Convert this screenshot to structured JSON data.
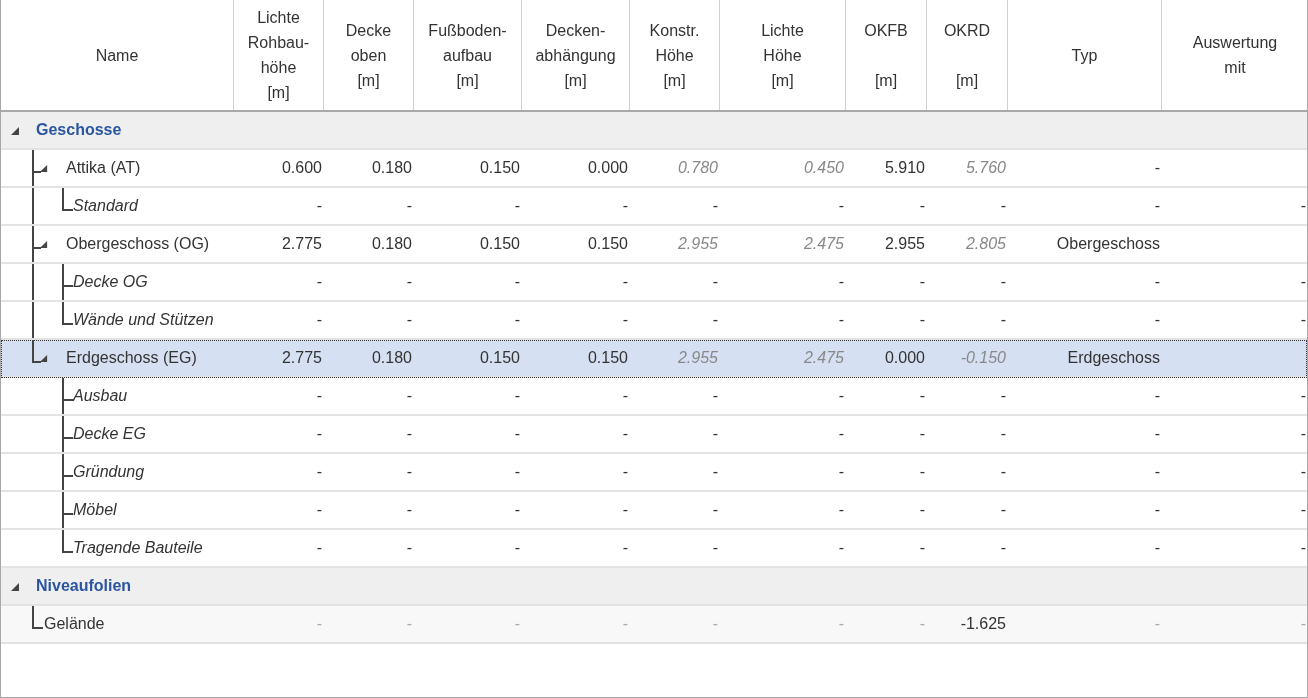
{
  "table": {
    "columns": [
      "Name",
      "Lichte\nRohbau-\nhöhe\n[m]",
      "Decke\noben\n[m]",
      "Fußboden-\naufbau\n[m]",
      "Decken-\nabhängung\n[m]",
      "Konstr.\nHöhe\n[m]",
      "Lichte\nHöhe\n[m]",
      "OKFB\n\n[m]",
      "OKRD\n\n[m]",
      "Typ",
      "Auswertung\nmit"
    ],
    "groups": [
      {
        "label": "Geschosse",
        "expanded": true,
        "children": [
          {
            "kind": "story",
            "name": "Attika (AT)",
            "expanded": true,
            "selected": false,
            "cells": [
              {
                "text": "0.600",
                "italic": false
              },
              {
                "text": "0.180",
                "italic": false
              },
              {
                "text": "0.150",
                "italic": false
              },
              {
                "text": "0.000",
                "italic": false
              },
              {
                "text": "0.780",
                "italic": true
              },
              {
                "text": "0.450",
                "italic": true
              },
              {
                "text": "5.910",
                "italic": false
              },
              {
                "text": "5.760",
                "italic": true
              },
              {
                "text": "-",
                "italic": false
              }
            ],
            "children": [
              {
                "kind": "part",
                "name": "Standard",
                "selected": false,
                "cells": [
                  "-",
                  "-",
                  "-",
                  "-",
                  "-",
                  "-",
                  "-",
                  "-",
                  "-",
                  "-"
                ]
              }
            ]
          },
          {
            "kind": "story",
            "name": "Obergeschoss (OG)",
            "expanded": true,
            "selected": false,
            "cells": [
              {
                "text": "2.775",
                "italic": false
              },
              {
                "text": "0.180",
                "italic": false
              },
              {
                "text": "0.150",
                "italic": false
              },
              {
                "text": "0.150",
                "italic": false
              },
              {
                "text": "2.955",
                "italic": true
              },
              {
                "text": "2.475",
                "italic": true
              },
              {
                "text": "2.955",
                "italic": false
              },
              {
                "text": "2.805",
                "italic": true
              },
              {
                "text": "Obergeschoss",
                "italic": false
              }
            ],
            "children": [
              {
                "kind": "part",
                "name": "Decke OG",
                "selected": false,
                "cells": [
                  "-",
                  "-",
                  "-",
                  "-",
                  "-",
                  "-",
                  "-",
                  "-",
                  "-",
                  "-"
                ]
              },
              {
                "kind": "part",
                "name": "Wände und Stützen",
                "selected": false,
                "cells": [
                  "-",
                  "-",
                  "-",
                  "-",
                  "-",
                  "-",
                  "-",
                  "-",
                  "-",
                  "-"
                ]
              }
            ]
          },
          {
            "kind": "story",
            "name": "Erdgeschoss (EG)",
            "expanded": true,
            "selected": true,
            "cells": [
              {
                "text": "2.775",
                "italic": false
              },
              {
                "text": "0.180",
                "italic": false
              },
              {
                "text": "0.150",
                "italic": false
              },
              {
                "text": "0.150",
                "italic": false
              },
              {
                "text": "2.955",
                "italic": true
              },
              {
                "text": "2.475",
                "italic": true
              },
              {
                "text": "0.000",
                "italic": false
              },
              {
                "text": "-0.150",
                "italic": true
              },
              {
                "text": "Erdgeschoss",
                "italic": false
              }
            ],
            "children": [
              {
                "kind": "part",
                "name": "Ausbau",
                "selected": false,
                "cells": [
                  "-",
                  "-",
                  "-",
                  "-",
                  "-",
                  "-",
                  "-",
                  "-",
                  "-",
                  "-"
                ]
              },
              {
                "kind": "part",
                "name": "Decke EG",
                "selected": false,
                "cells": [
                  "-",
                  "-",
                  "-",
                  "-",
                  "-",
                  "-",
                  "-",
                  "-",
                  "-",
                  "-"
                ]
              },
              {
                "kind": "part",
                "name": "Gründung",
                "selected": false,
                "cells": [
                  "-",
                  "-",
                  "-",
                  "-",
                  "-",
                  "-",
                  "-",
                  "-",
                  "-",
                  "-"
                ]
              },
              {
                "kind": "part",
                "name": "Möbel",
                "selected": false,
                "cells": [
                  "-",
                  "-",
                  "-",
                  "-",
                  "-",
                  "-",
                  "-",
                  "-",
                  "-",
                  "-"
                ]
              },
              {
                "kind": "part",
                "name": "Tragende Bauteile",
                "selected": false,
                "cells": [
                  "-",
                  "-",
                  "-",
                  "-",
                  "-",
                  "-",
                  "-",
                  "-",
                  "-",
                  "-"
                ]
              }
            ]
          }
        ]
      },
      {
        "label": "Niveaufolien",
        "expanded": true,
        "children": [
          {
            "kind": "level",
            "name": "Gelände",
            "selected": false,
            "cells": [
              "-",
              "-",
              "-",
              "-",
              "-",
              "-",
              "-",
              "-1.625",
              "-",
              "-"
            ]
          }
        ]
      }
    ]
  }
}
